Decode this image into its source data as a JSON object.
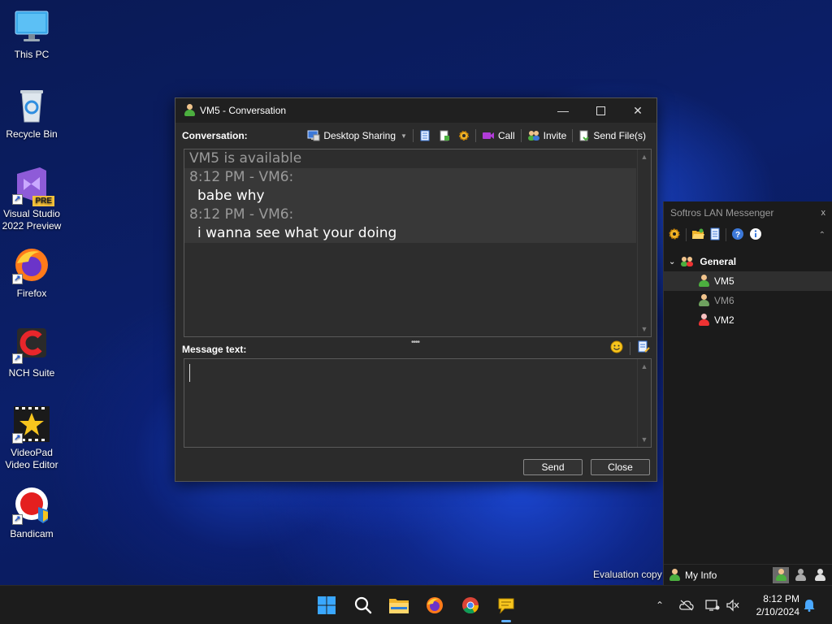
{
  "desktop": {
    "icons": [
      {
        "label": "This PC"
      },
      {
        "label": "Recycle Bin"
      },
      {
        "label": "Visual Studio 2022 Preview",
        "badge": "PRE"
      },
      {
        "label": "Firefox"
      },
      {
        "label": "NCH Suite"
      },
      {
        "label": "VideoPad Video Editor"
      },
      {
        "label": "Bandicam"
      }
    ],
    "evaluation_text": "Evaluation copy"
  },
  "conversation": {
    "title": "VM5 - Conversation",
    "toolbar": {
      "label": "Conversation:",
      "desktop_sharing": "Desktop Sharing",
      "call": "Call",
      "invite": "Invite",
      "send_files": "Send File(s)"
    },
    "history": {
      "status": "VM5 is available",
      "messages": [
        {
          "header": "8:12 PM - VM6:",
          "text": "babe why"
        },
        {
          "header": "8:12 PM - VM6:",
          "text": "i wanna see what your doing"
        }
      ]
    },
    "message_label": "Message text:",
    "message_value": "",
    "send_label": "Send",
    "close_label": "Close"
  },
  "messenger": {
    "title": "Softros LAN Messenger",
    "close_glyph": "x",
    "group": "General",
    "users": [
      {
        "name": "VM5",
        "status": "online",
        "color": "#ffffff"
      },
      {
        "name": "VM6",
        "status": "away",
        "color": "#9a9a9a"
      },
      {
        "name": "VM2",
        "status": "busy",
        "color": "#ffffff"
      }
    ],
    "my_info": "My Info"
  },
  "taskbar": {
    "apps": [
      "start-icon",
      "search-icon",
      "file-explorer-icon",
      "firefox-icon",
      "chrome-icon",
      "messenger-icon"
    ],
    "time": "8:12 PM",
    "date": "2/10/2024"
  },
  "colors": {
    "accent": "#60b0ff",
    "window_bg": "#2b2b2b",
    "online": "#4caf3f",
    "busy": "#e33333"
  }
}
